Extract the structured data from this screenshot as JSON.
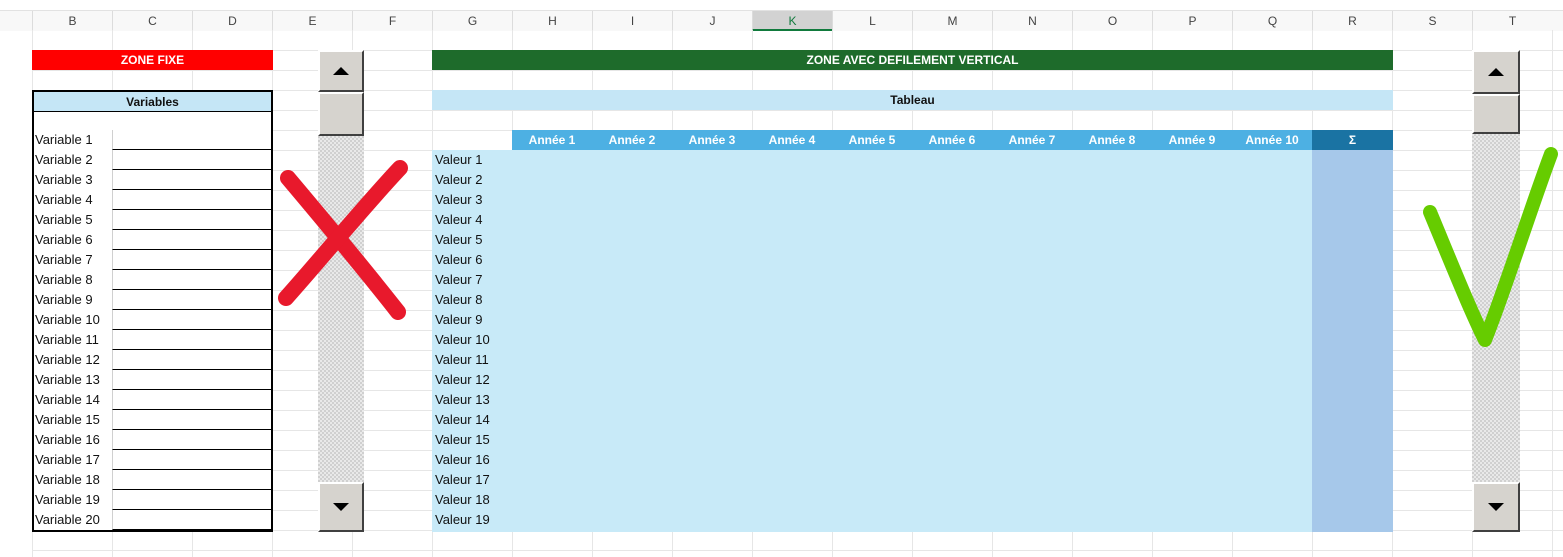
{
  "columns": {
    "letters": [
      "B",
      "C",
      "D",
      "E",
      "F",
      "G",
      "H",
      "I",
      "J",
      "K",
      "L",
      "M",
      "N",
      "O",
      "P",
      "Q",
      "R",
      "S",
      "T"
    ],
    "selected": "K"
  },
  "zone_fixe": {
    "title": "ZONE FIXE",
    "variables_header": "Variables",
    "variables": [
      "Variable 1",
      "Variable 2",
      "Variable 3",
      "Variable 4",
      "Variable 5",
      "Variable 6",
      "Variable 7",
      "Variable 8",
      "Variable 9",
      "Variable 10",
      "Variable 11",
      "Variable 12",
      "Variable 13",
      "Variable 14",
      "Variable 15",
      "Variable 16",
      "Variable 17",
      "Variable 18",
      "Variable 19",
      "Variable 20"
    ]
  },
  "zone_defilement": {
    "title": "ZONE AVEC DEFILEMENT VERTICAL",
    "table_header": "Tableau",
    "years": [
      "Année 1",
      "Année 2",
      "Année 3",
      "Année 4",
      "Année 5",
      "Année 6",
      "Année 7",
      "Année 8",
      "Année 9",
      "Année 10"
    ],
    "sum_header": "Σ",
    "values": [
      "Valeur 1",
      "Valeur 2",
      "Valeur 3",
      "Valeur 4",
      "Valeur 5",
      "Valeur 6",
      "Valeur 7",
      "Valeur 8",
      "Valeur 9",
      "Valeur 10",
      "Valeur 11",
      "Valeur 12",
      "Valeur 13",
      "Valeur 14",
      "Valeur 15",
      "Valeur 16",
      "Valeur 17",
      "Valeur 18",
      "Valeur 19"
    ]
  },
  "colors": {
    "red_header": "#ff0000",
    "green_header": "#1e6b2b",
    "light_blue": "#c5e6f6",
    "year_blue": "#4db0e3",
    "sum_blue": "#1a73a3",
    "sum_column": "#a6c8ea",
    "cross_mark": "#e8192c",
    "check_mark": "#66cc00"
  },
  "icons": {
    "scroll_up": "triangle-up",
    "scroll_down": "triangle-down",
    "cross": "red-cross-mark",
    "check": "green-check-mark"
  }
}
